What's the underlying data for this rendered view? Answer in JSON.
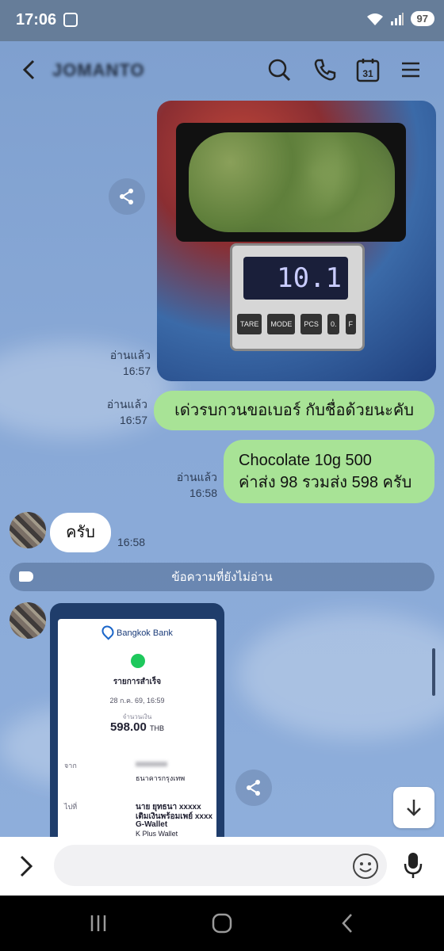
{
  "status": {
    "time": "17:06",
    "battery": "97",
    "signal_badge": "6"
  },
  "header": {
    "title": "JOMANTO"
  },
  "photo": {
    "scale_reading": "10.1",
    "scale_buttons": [
      "TARE",
      "MODE",
      "PCS",
      "0.",
      "F"
    ]
  },
  "messages": [
    {
      "type": "image",
      "read": "อ่านแล้ว",
      "time": "16:57"
    },
    {
      "type": "text",
      "read": "อ่านแล้ว",
      "time": "16:57",
      "text": "เด่วรบกวนขอเบอร์ กับชื่อด้วยนะคับ"
    },
    {
      "type": "text",
      "read": "อ่านแล้ว",
      "time": "16:58",
      "lines": [
        "Chocolate 10g 500",
        "ค่าส่ง 98 รวมส่ง 598 ครับ"
      ]
    },
    {
      "type": "incoming",
      "time": "16:58",
      "text": "ครับ"
    }
  ],
  "unread_label": "ข้อความที่ยังไม่อ่าน",
  "receipt": {
    "bank": "Bangkok Bank",
    "status": "รายการสำเร็จ",
    "datetime": "28 ก.ค. 69, 16:59",
    "amount_label": "จำนวนเงิน",
    "amount": "598.00",
    "currency": "THB",
    "from_label": "จาก",
    "from_name": "xxxxxxxx",
    "from_bank": "ธนาคารกรุงเทพ",
    "to_label": "ไปที่",
    "to_name": "นาย ยุทธนา xxxxx",
    "to_desc": "เติมเงินพร้อมเพย์ xxxx",
    "to_wallet": "G-Wallet",
    "to_wallet2": "K Plus Wallet"
  },
  "input": {
    "placeholder": ""
  },
  "colors": {
    "bubble_out": "#a8e396",
    "chat_bg": "#7f9fce"
  }
}
